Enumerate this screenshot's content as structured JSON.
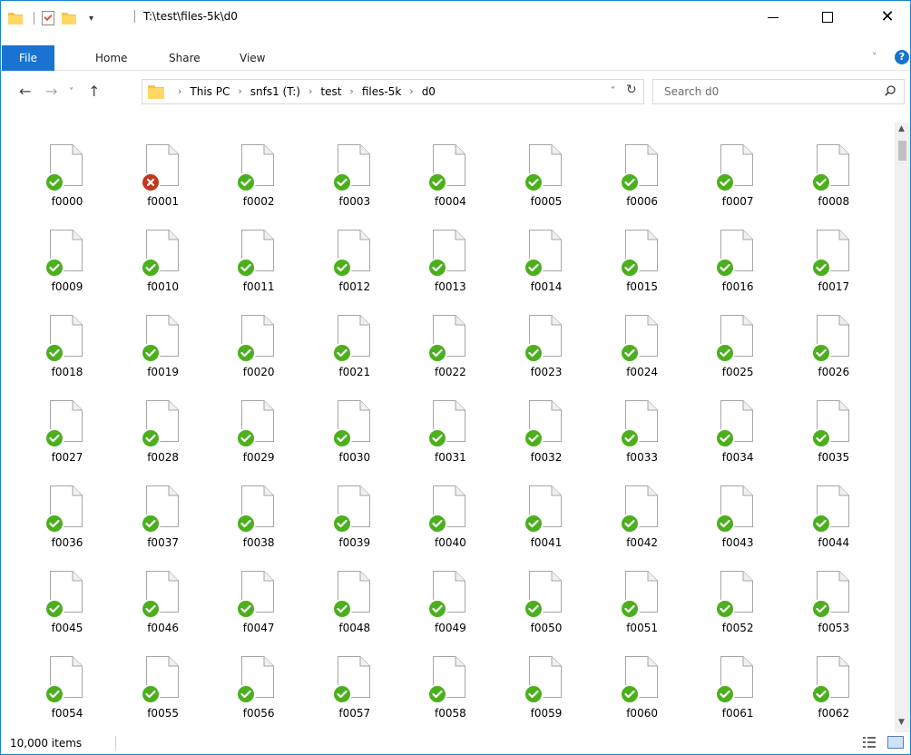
{
  "window": {
    "title": "T:\\test\\files-5k\\d0"
  },
  "ribbon": {
    "tabs": [
      "File",
      "Home",
      "Share",
      "View"
    ],
    "help_label": "?"
  },
  "nav": {
    "back_glyph": "←",
    "forward_glyph": "→",
    "recent_glyph": "˅",
    "up_glyph": "↑"
  },
  "address": {
    "breadcrumbs": [
      "This PC",
      "snfs1 (T:)",
      "test",
      "files-5k",
      "d0"
    ],
    "dropdown_glyph": "˅",
    "refresh_glyph": "↻"
  },
  "search": {
    "placeholder": "Search d0"
  },
  "files": [
    {
      "name": "f0000",
      "status": "ok"
    },
    {
      "name": "f0001",
      "status": "error"
    },
    {
      "name": "f0002",
      "status": "ok"
    },
    {
      "name": "f0003",
      "status": "ok"
    },
    {
      "name": "f0004",
      "status": "ok"
    },
    {
      "name": "f0005",
      "status": "ok"
    },
    {
      "name": "f0006",
      "status": "ok"
    },
    {
      "name": "f0007",
      "status": "ok"
    },
    {
      "name": "f0008",
      "status": "ok"
    },
    {
      "name": "f0009",
      "status": "ok"
    },
    {
      "name": "f0010",
      "status": "ok"
    },
    {
      "name": "f0011",
      "status": "ok"
    },
    {
      "name": "f0012",
      "status": "ok"
    },
    {
      "name": "f0013",
      "status": "ok"
    },
    {
      "name": "f0014",
      "status": "ok"
    },
    {
      "name": "f0015",
      "status": "ok"
    },
    {
      "name": "f0016",
      "status": "ok"
    },
    {
      "name": "f0017",
      "status": "ok"
    },
    {
      "name": "f0018",
      "status": "ok"
    },
    {
      "name": "f0019",
      "status": "ok"
    },
    {
      "name": "f0020",
      "status": "ok"
    },
    {
      "name": "f0021",
      "status": "ok"
    },
    {
      "name": "f0022",
      "status": "ok"
    },
    {
      "name": "f0023",
      "status": "ok"
    },
    {
      "name": "f0024",
      "status": "ok"
    },
    {
      "name": "f0025",
      "status": "ok"
    },
    {
      "name": "f0026",
      "status": "ok"
    },
    {
      "name": "f0027",
      "status": "ok"
    },
    {
      "name": "f0028",
      "status": "ok"
    },
    {
      "name": "f0029",
      "status": "ok"
    },
    {
      "name": "f0030",
      "status": "ok"
    },
    {
      "name": "f0031",
      "status": "ok"
    },
    {
      "name": "f0032",
      "status": "ok"
    },
    {
      "name": "f0033",
      "status": "ok"
    },
    {
      "name": "f0034",
      "status": "ok"
    },
    {
      "name": "f0035",
      "status": "ok"
    },
    {
      "name": "f0036",
      "status": "ok"
    },
    {
      "name": "f0037",
      "status": "ok"
    },
    {
      "name": "f0038",
      "status": "ok"
    },
    {
      "name": "f0039",
      "status": "ok"
    },
    {
      "name": "f0040",
      "status": "ok"
    },
    {
      "name": "f0041",
      "status": "ok"
    },
    {
      "name": "f0042",
      "status": "ok"
    },
    {
      "name": "f0043",
      "status": "ok"
    },
    {
      "name": "f0044",
      "status": "ok"
    },
    {
      "name": "f0045",
      "status": "ok"
    },
    {
      "name": "f0046",
      "status": "ok"
    },
    {
      "name": "f0047",
      "status": "ok"
    },
    {
      "name": "f0048",
      "status": "ok"
    },
    {
      "name": "f0049",
      "status": "ok"
    },
    {
      "name": "f0050",
      "status": "ok"
    },
    {
      "name": "f0051",
      "status": "ok"
    },
    {
      "name": "f0052",
      "status": "ok"
    },
    {
      "name": "f0053",
      "status": "ok"
    },
    {
      "name": "f0054",
      "status": "ok"
    },
    {
      "name": "f0055",
      "status": "ok"
    },
    {
      "name": "f0056",
      "status": "ok"
    },
    {
      "name": "f0057",
      "status": "ok"
    },
    {
      "name": "f0058",
      "status": "ok"
    },
    {
      "name": "f0059",
      "status": "ok"
    },
    {
      "name": "f0060",
      "status": "ok"
    },
    {
      "name": "f0061",
      "status": "ok"
    },
    {
      "name": "f0062",
      "status": "ok"
    }
  ],
  "status_bar": {
    "item_count": "10,000 items"
  },
  "colors": {
    "accent": "#1a73d0",
    "sync_ok": "#4caf1e",
    "sync_error": "#c2381d",
    "folder": "#f5c547"
  }
}
